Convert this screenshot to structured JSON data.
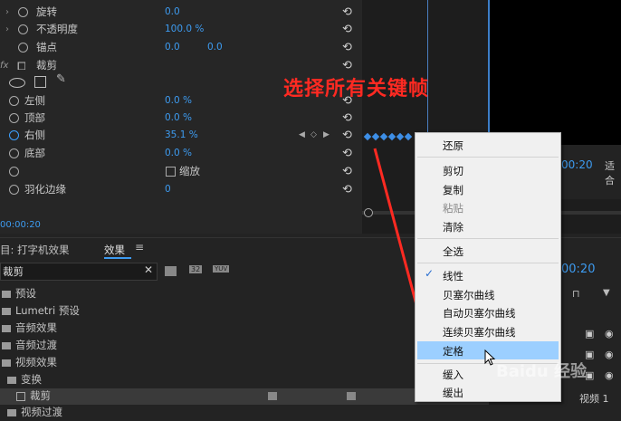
{
  "effect_controls": {
    "rows": [
      {
        "label": "旋转",
        "value1": "0.0"
      },
      {
        "label": "不透明度",
        "value1": "100.0 %"
      },
      {
        "label": "锚点",
        "value1": "0.0",
        "value2": "0.0"
      },
      {
        "label": "裁剪",
        "fx": "fx"
      },
      {
        "label": "左侧",
        "value1": "0.0 %"
      },
      {
        "label": "顶部",
        "value1": "0.0 %"
      },
      {
        "label": "右侧",
        "value1": "35.1 %"
      },
      {
        "label": "底部",
        "value1": "0.0 %"
      },
      {
        "label": "缩放"
      },
      {
        "label": "羽化边缘",
        "value1": "0"
      }
    ],
    "timecode": "00:00:20"
  },
  "timeline": {
    "timecode": "00:20",
    "label_right": "适合"
  },
  "annotation": "选择所有关键帧",
  "bottom": {
    "tab1": "目: 打字机效果",
    "tab2": "效果",
    "search_value": "裁剪",
    "folders": [
      "预设",
      "Lumetri 预设",
      "音频效果",
      "音频过渡",
      "视频效果",
      "变换",
      "裁剪",
      "视频过渡"
    ],
    "badges": [
      "32",
      "YUV"
    ],
    "right_timecode": "00:20",
    "track_label": "视频 1"
  },
  "context_menu": {
    "items": [
      "还原",
      "剪切",
      "复制",
      "粘贴",
      "清除",
      "全选",
      "线性",
      "贝塞尔曲线",
      "自动贝塞尔曲线",
      "连续贝塞尔曲线",
      "定格",
      "缓入",
      "缓出"
    ],
    "checked": "线性",
    "highlighted": "定格"
  },
  "watermark": "Baidu 经验",
  "colors": {
    "accent": "#3d9bf0",
    "annotation": "#ff2a22",
    "menu_highlight": "#9ccfff"
  }
}
